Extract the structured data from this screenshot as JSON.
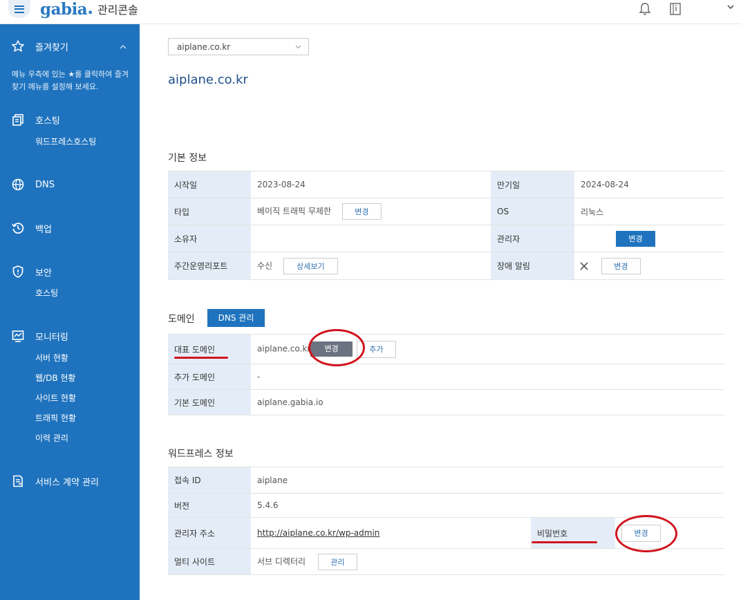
{
  "header": {
    "brand": "gabia",
    "console_label": "관리콘솔"
  },
  "sidebar": {
    "favorites": {
      "label": "즐겨찾기",
      "note": "메뉴 우측에 있는 ★를 클릭하여 즐겨찾기 메뉴를 설정해 보세요."
    },
    "hosting": {
      "label": "호스팅",
      "sub": [
        "워드프레스호스팅"
      ]
    },
    "dns": {
      "label": "DNS"
    },
    "backup": {
      "label": "백업"
    },
    "security": {
      "label": "보안",
      "sub": [
        "호스팅"
      ]
    },
    "monitoring": {
      "label": "모니터링",
      "sub": [
        "서버 현황",
        "웹/DB 현황",
        "사이트 현황",
        "트래픽 현황",
        "이력 관리"
      ]
    },
    "contract": {
      "label": "서비스 계약 관리"
    }
  },
  "main": {
    "domain_select": "aiplane.co.kr",
    "page_title": "aiplane.co.kr",
    "basic": {
      "title": "기본 정보",
      "start_label": "시작일",
      "start_value": "2023-08-24",
      "expire_label": "만기일",
      "expire_value": "2024-08-24",
      "type_label": "타입",
      "type_value": "베이직 트래픽 무제한",
      "type_btn": "변경",
      "os_label": "OS",
      "os_value": "리눅스",
      "owner_label": "소유자",
      "admin_label": "관리자",
      "admin_btn": "변경",
      "report_label": "주간운영리포트",
      "report_value": "수신",
      "report_btn": "상세보기",
      "alert_label": "장애 알림",
      "alert_btn": "변경"
    },
    "domain": {
      "title": "도메인",
      "dns_btn": "DNS 관리",
      "rep_label": "대표 도메인",
      "rep_value": "aiplane.co.kr",
      "rep_change_btn": "변경",
      "rep_add_btn": "추가",
      "extra_label": "추가 도메인",
      "extra_value": "-",
      "default_label": "기본 도메인",
      "default_value": "aiplane.gabia.io"
    },
    "wordpress": {
      "title": "워드프레스 정보",
      "id_label": "접속 ID",
      "id_value": "aiplane",
      "version_label": "버전",
      "version_value": "5.4.6",
      "admin_url_label": "관리자 주소",
      "admin_url_value": "http://aiplane.co.kr/wp-admin",
      "password_label": "비밀번호",
      "password_btn": "변경",
      "multisite_label": "멀티 사이트",
      "multisite_value": "서브 디렉터리",
      "multisite_btn": "관리"
    }
  },
  "colors": {
    "sidebar": "#1f73be",
    "label_bg": "#e4edf7",
    "annotation": "#d0141e"
  }
}
